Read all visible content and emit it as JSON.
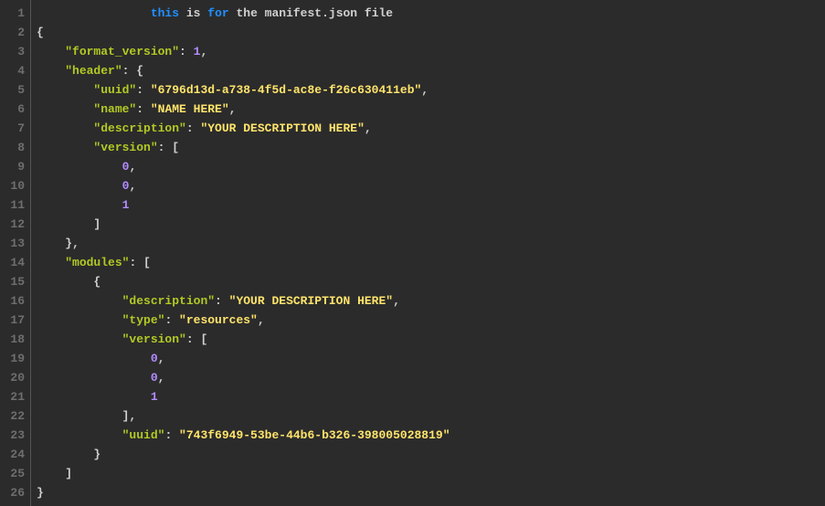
{
  "lines": [
    [
      [
        "ind",
        "                "
      ],
      [
        "kw",
        "this"
      ],
      [
        "id",
        " is "
      ],
      [
        "kw",
        "for"
      ],
      [
        "id",
        " the manifest.json file"
      ]
    ],
    [
      [
        "punc",
        "{"
      ]
    ],
    [
      [
        "ind",
        "    "
      ],
      [
        "key",
        "\"format_version\""
      ],
      [
        "punc",
        ": "
      ],
      [
        "num",
        "1"
      ],
      [
        "punc",
        ","
      ]
    ],
    [
      [
        "ind",
        "    "
      ],
      [
        "key",
        "\"header\""
      ],
      [
        "punc",
        ": {"
      ]
    ],
    [
      [
        "ind",
        "        "
      ],
      [
        "key",
        "\"uuid\""
      ],
      [
        "punc",
        ": "
      ],
      [
        "str",
        "\"6796d13d-a738-4f5d-ac8e-f26c630411eb\""
      ],
      [
        "punc",
        ","
      ]
    ],
    [
      [
        "ind",
        "        "
      ],
      [
        "key",
        "\"name\""
      ],
      [
        "punc",
        ": "
      ],
      [
        "str",
        "\"NAME HERE\""
      ],
      [
        "punc",
        ","
      ]
    ],
    [
      [
        "ind",
        "        "
      ],
      [
        "key",
        "\"description\""
      ],
      [
        "punc",
        ": "
      ],
      [
        "str",
        "\"YOUR DESCRIPTION HERE\""
      ],
      [
        "punc",
        ","
      ]
    ],
    [
      [
        "ind",
        "        "
      ],
      [
        "key",
        "\"version\""
      ],
      [
        "punc",
        ": ["
      ]
    ],
    [
      [
        "ind",
        "            "
      ],
      [
        "num",
        "0"
      ],
      [
        "punc",
        ","
      ]
    ],
    [
      [
        "ind",
        "            "
      ],
      [
        "num",
        "0"
      ],
      [
        "punc",
        ","
      ]
    ],
    [
      [
        "ind",
        "            "
      ],
      [
        "num",
        "1"
      ]
    ],
    [
      [
        "ind",
        "        "
      ],
      [
        "punc",
        "]"
      ]
    ],
    [
      [
        "ind",
        "    "
      ],
      [
        "punc",
        "},"
      ]
    ],
    [
      [
        "ind",
        "    "
      ],
      [
        "key",
        "\"modules\""
      ],
      [
        "punc",
        ": ["
      ]
    ],
    [
      [
        "ind",
        "        "
      ],
      [
        "punc",
        "{"
      ]
    ],
    [
      [
        "ind",
        "            "
      ],
      [
        "key",
        "\"description\""
      ],
      [
        "punc",
        ": "
      ],
      [
        "str",
        "\"YOUR DESCRIPTION HERE\""
      ],
      [
        "punc",
        ","
      ]
    ],
    [
      [
        "ind",
        "            "
      ],
      [
        "key",
        "\"type\""
      ],
      [
        "punc",
        ": "
      ],
      [
        "str",
        "\"resources\""
      ],
      [
        "punc",
        ","
      ]
    ],
    [
      [
        "ind",
        "            "
      ],
      [
        "key",
        "\"version\""
      ],
      [
        "punc",
        ": ["
      ]
    ],
    [
      [
        "ind",
        "                "
      ],
      [
        "num",
        "0"
      ],
      [
        "punc",
        ","
      ]
    ],
    [
      [
        "ind",
        "                "
      ],
      [
        "num",
        "0"
      ],
      [
        "punc",
        ","
      ]
    ],
    [
      [
        "ind",
        "                "
      ],
      [
        "num",
        "1"
      ]
    ],
    [
      [
        "ind",
        "            "
      ],
      [
        "punc",
        "],"
      ]
    ],
    [
      [
        "ind",
        "            "
      ],
      [
        "key",
        "\"uuid\""
      ],
      [
        "punc",
        ": "
      ],
      [
        "str",
        "\"743f6949-53be-44b6-b326-398005028819\""
      ]
    ],
    [
      [
        "ind",
        "        "
      ],
      [
        "punc",
        "}"
      ]
    ],
    [
      [
        "ind",
        "    "
      ],
      [
        "punc",
        "]"
      ]
    ],
    [
      [
        "punc",
        "}"
      ]
    ]
  ],
  "token_class_map": {
    "kw": "tok-kw",
    "id": "tok-id",
    "key": "tok-key",
    "str": "tok-str",
    "num": "tok-num",
    "punc": "tok-punc",
    "ind": "tok-punc"
  }
}
